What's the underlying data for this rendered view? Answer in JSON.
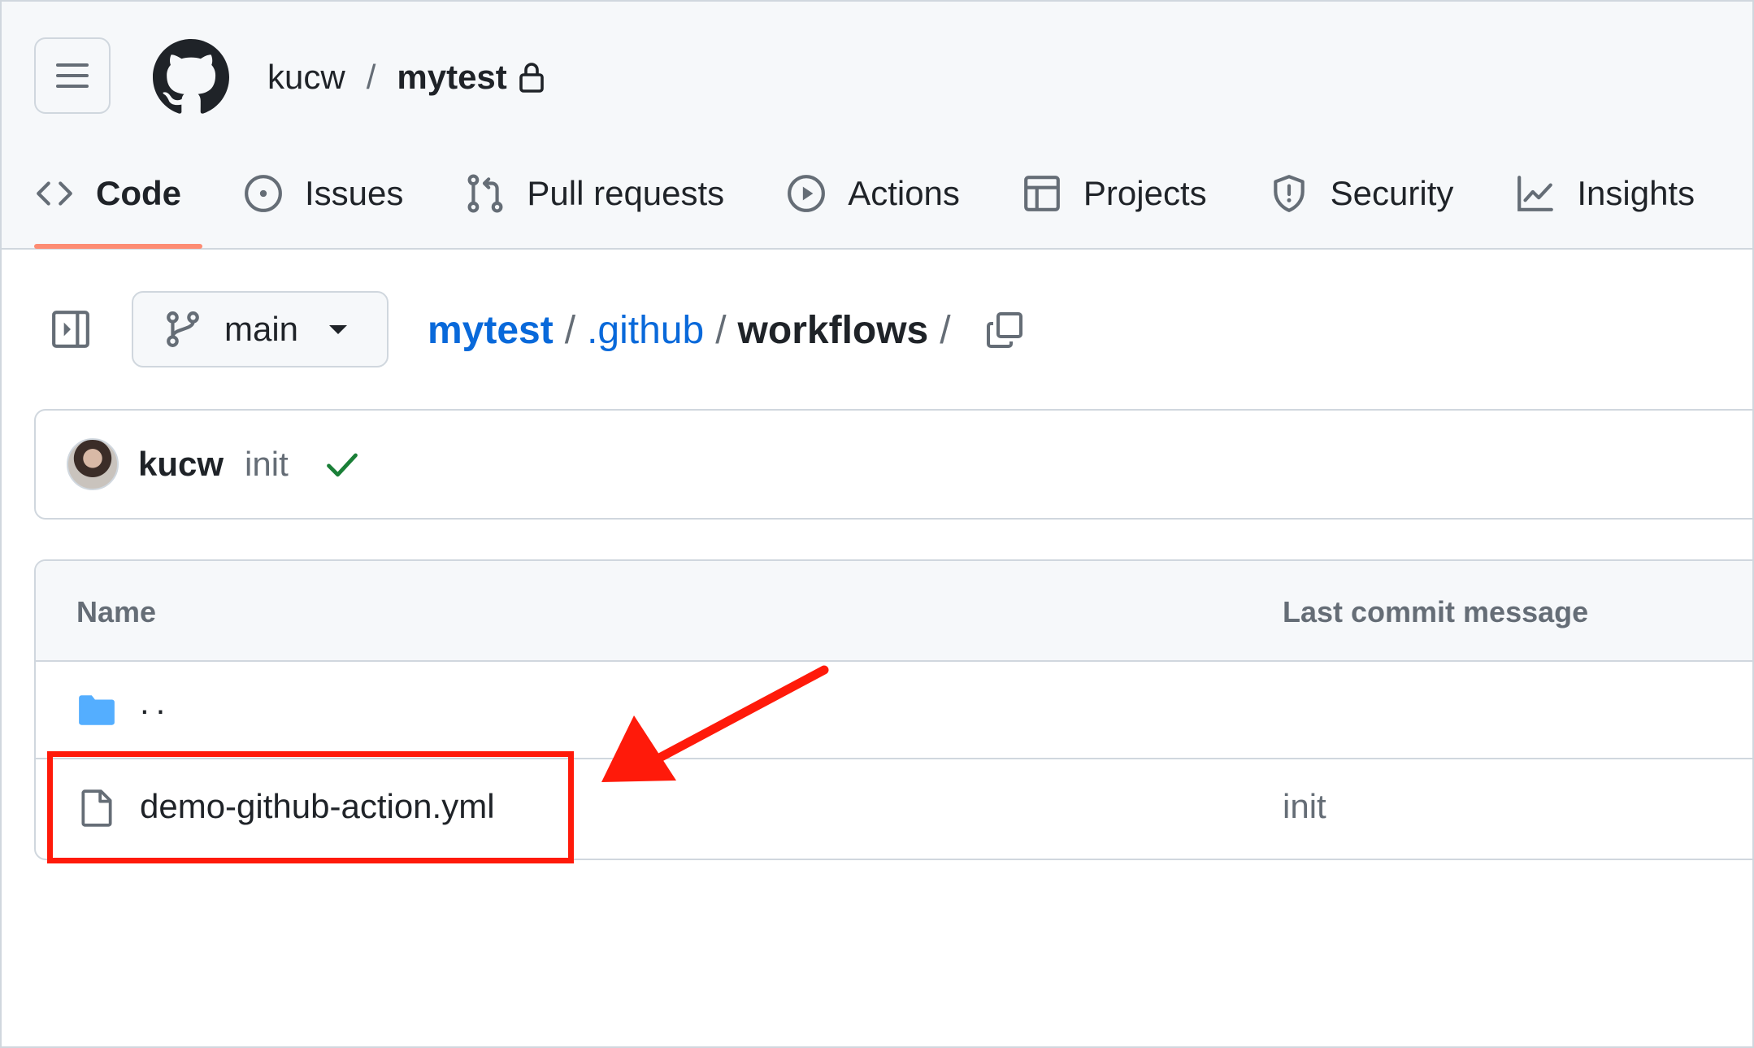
{
  "header": {
    "owner": "kucw",
    "separator": "/",
    "repo": "mytest"
  },
  "tabs": [
    {
      "label": "Code",
      "icon": "code-icon",
      "active": true
    },
    {
      "label": "Issues",
      "icon": "issue-opened-icon"
    },
    {
      "label": "Pull requests",
      "icon": "git-pull-request-icon"
    },
    {
      "label": "Actions",
      "icon": "play-icon"
    },
    {
      "label": "Projects",
      "icon": "table-icon"
    },
    {
      "label": "Security",
      "icon": "shield-icon"
    },
    {
      "label": "Insights",
      "icon": "graph-icon"
    }
  ],
  "branch": {
    "name": "main"
  },
  "breadcrumb": {
    "root": "mytest",
    "segment1": ".github",
    "current": "workflows",
    "separator": "/"
  },
  "commit": {
    "author": "kucw",
    "message": "init",
    "status": "success"
  },
  "table": {
    "headers": {
      "name": "Name",
      "message": "Last commit message"
    },
    "rows": [
      {
        "name": "..",
        "type": "folder",
        "message": ""
      },
      {
        "name": "demo-github-action.yml",
        "type": "file",
        "message": "init"
      }
    ]
  },
  "colors": {
    "accent_link": "#0969da",
    "active_tab_underline": "#fd8c73",
    "success_green": "#1a7f37",
    "folder_blue": "#54aeff",
    "annotation_red": "#ff1a0a"
  }
}
